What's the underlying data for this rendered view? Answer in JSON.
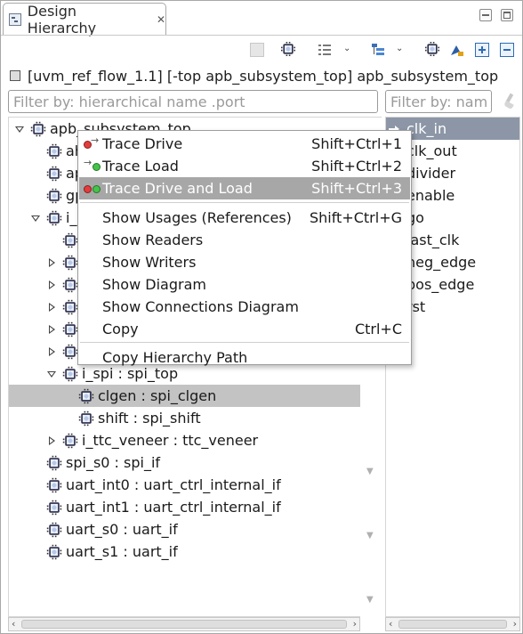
{
  "view": {
    "title": "Design Hierarchy",
    "close_glyph": "✕"
  },
  "toolbar": {
    "icons": [
      "stop-icon",
      "gear-icon",
      "list-icon",
      "hierarchy-icon",
      "chip-icon",
      "paint-icon",
      "expand-all-icon",
      "collapse-all-icon"
    ]
  },
  "path": {
    "text": "[uvm_ref_flow_1.1] [-top apb_subsystem_top] apb_subsystem_top"
  },
  "filters": {
    "left_placeholder": "Filter by: hierarchical name .port",
    "right_placeholder": "Filter by: name"
  },
  "tree": {
    "rows": [
      {
        "label": "apb_subsystem_top",
        "twisty": "open"
      },
      {
        "label": "ahb",
        "twisty": "none"
      },
      {
        "label": "apb",
        "twisty": "none"
      },
      {
        "label": "gpi",
        "twisty": "none"
      },
      {
        "label": "i_a",
        "twisty": "open"
      },
      {
        "label": "i",
        "twisty": "none"
      },
      {
        "label": "i",
        "twisty": "closed"
      },
      {
        "label": "i",
        "twisty": "closed"
      },
      {
        "label": "i",
        "twisty": "closed"
      },
      {
        "label": "i",
        "twisty": "closed"
      },
      {
        "label": "i",
        "twisty": "closed"
      },
      {
        "label": "i_spi : spi_top",
        "twisty": "open"
      },
      {
        "label": "clgen : spi_clgen",
        "twisty": "none",
        "selected": true
      },
      {
        "label": "shift : spi_shift",
        "twisty": "none"
      },
      {
        "label": "i_ttc_veneer : ttc_veneer",
        "twisty": "closed"
      },
      {
        "label": "spi_s0 : spi_if",
        "twisty": "none"
      },
      {
        "label": "uart_int0 : uart_ctrl_internal_if",
        "twisty": "none"
      },
      {
        "label": "uart_int1 : uart_ctrl_internal_if",
        "twisty": "none"
      },
      {
        "label": "uart_s0 : uart_if",
        "twisty": "none"
      },
      {
        "label": "uart_s1 : uart_if",
        "twisty": "none"
      }
    ]
  },
  "ports": {
    "items": [
      {
        "label": "clk_in",
        "selected": true
      },
      {
        "label": "clk_out"
      },
      {
        "label": "divider"
      },
      {
        "label": "enable"
      },
      {
        "label": "go"
      },
      {
        "label": "last_clk"
      },
      {
        "label": "neg_edge"
      },
      {
        "label": "pos_edge"
      },
      {
        "label": "rst"
      }
    ]
  },
  "context_menu": {
    "items": [
      {
        "label": "Trace Drive",
        "accel": "Shift+Ctrl+1",
        "icon": "trace-drive-icon"
      },
      {
        "label": "Trace Load",
        "accel": "Shift+Ctrl+2",
        "icon": "trace-load-icon"
      },
      {
        "label": "Trace Drive and Load",
        "accel": "Shift+Ctrl+3",
        "icon": "trace-drive-load-icon",
        "hover": true
      },
      {
        "label": "Show Usages (References)",
        "accel": "Shift+Ctrl+G"
      },
      {
        "label": "Show Readers",
        "accel": ""
      },
      {
        "label": "Show Writers",
        "accel": ""
      },
      {
        "label": "Show Diagram",
        "accel": ""
      },
      {
        "label": "Show Connections Diagram",
        "accel": ""
      },
      {
        "label": "Copy",
        "accel": "Ctrl+C"
      },
      {
        "label": "Copy Hierarchy Path",
        "accel": ""
      }
    ]
  },
  "scroll": {
    "left_arrow": "‹",
    "right_arrow": "›",
    "down_arrow": "▼"
  }
}
